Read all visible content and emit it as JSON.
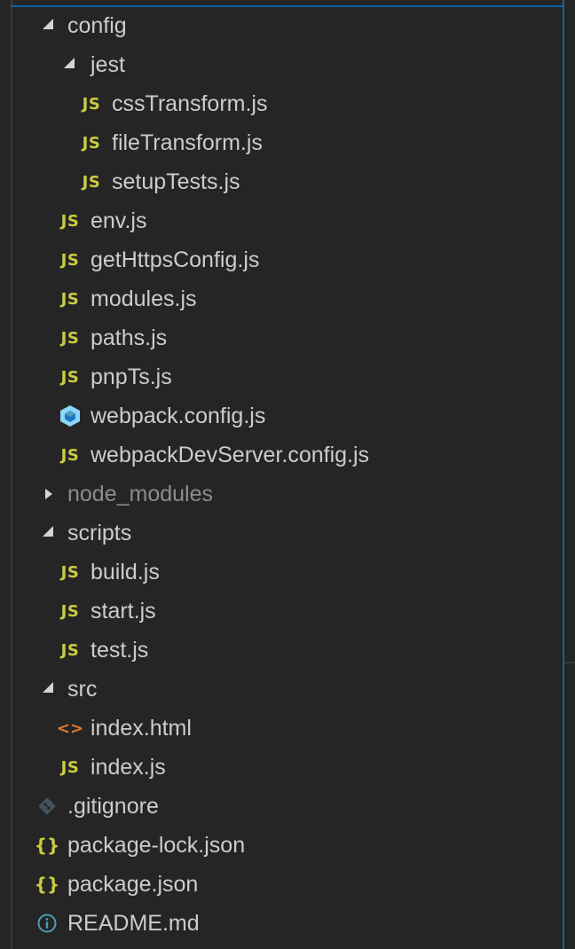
{
  "colors": {
    "background": "#252526",
    "text": "#cccccc",
    "dimmed_text": "#8c8c8c",
    "js_icon": "#cbcb41",
    "html_icon": "#e37933",
    "webpack_icon": "#519aba",
    "focus_border": "#0e639c"
  },
  "tree": {
    "config": {
      "label": "config",
      "icon": "chevron-down-icon"
    },
    "jest": {
      "label": "jest",
      "icon": "chevron-down-icon"
    },
    "cssTransform": {
      "label": "cssTransform.js",
      "icon_text": "JS"
    },
    "fileTransform": {
      "label": "fileTransform.js",
      "icon_text": "JS"
    },
    "setupTests": {
      "label": "setupTests.js",
      "icon_text": "JS"
    },
    "env": {
      "label": "env.js",
      "icon_text": "JS"
    },
    "getHttpsConfig": {
      "label": "getHttpsConfig.js",
      "icon_text": "JS"
    },
    "modules": {
      "label": "modules.js",
      "icon_text": "JS"
    },
    "paths": {
      "label": "paths.js",
      "icon_text": "JS"
    },
    "pnpTs": {
      "label": "pnpTs.js",
      "icon_text": "JS"
    },
    "webpackConfig": {
      "label": "webpack.config.js",
      "icon": "webpack-cube-icon"
    },
    "webpackDevServer": {
      "label": "webpackDevServer.config.js",
      "icon_text": "JS"
    },
    "node_modules": {
      "label": "node_modules",
      "icon": "chevron-right-icon"
    },
    "scripts": {
      "label": "scripts",
      "icon": "chevron-down-icon"
    },
    "build": {
      "label": "build.js",
      "icon_text": "JS"
    },
    "start": {
      "label": "start.js",
      "icon_text": "JS"
    },
    "test": {
      "label": "test.js",
      "icon_text": "JS"
    },
    "src": {
      "label": "src",
      "icon": "chevron-down-icon"
    },
    "indexHtml": {
      "label": "index.html",
      "icon_text": "<>"
    },
    "indexJs": {
      "label": "index.js",
      "icon_text": "JS"
    },
    "gitignore": {
      "label": ".gitignore",
      "icon": "git-icon"
    },
    "packageLock": {
      "label": "package-lock.json",
      "icon_text": "{}"
    },
    "packageJson": {
      "label": "package.json",
      "icon_text": "{}"
    },
    "readme": {
      "label": "README.md",
      "icon": "info-icon"
    }
  }
}
